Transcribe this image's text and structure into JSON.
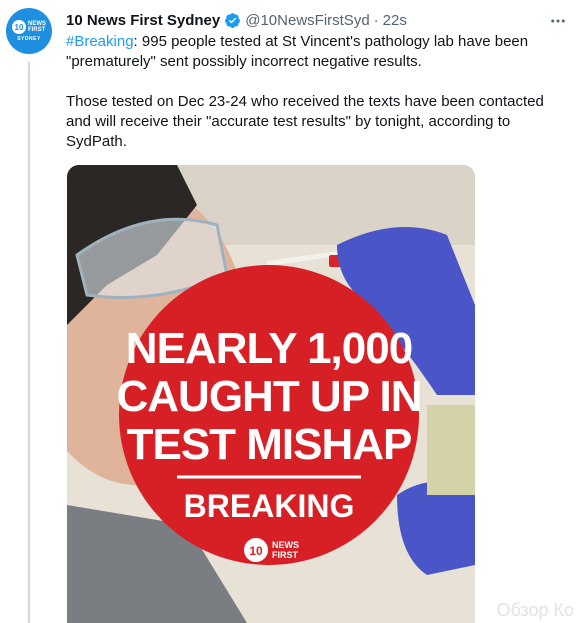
{
  "tweet": {
    "author_name": "10 News First Sydney",
    "handle": "@10NewsFirstSyd",
    "separator": "·",
    "timestamp": "22s",
    "more_icon": "more-horizontal-icon",
    "verified_icon": "verified-badge-icon",
    "hashtag": "#Breaking",
    "text_after_hashtag": ": 995 people tested at St Vincent's pathology lab have been \"prematurely\" sent possibly incorrect negative results.\n\nThose tested on Dec 23-24 who received the texts have been contacted and will receive their \"accurate test results\" by tonight, according to SydPath."
  },
  "avatar": {
    "logo_number": "10",
    "logo_line1": "NEWS",
    "logo_line2": "FIRST",
    "city": "SYDNEY"
  },
  "media": {
    "headline_line1": "NEARLY 1,000",
    "headline_line2": "CAUGHT UP IN",
    "headline_line3": "TEST MISHAP",
    "label": "BREAKING",
    "logo_number": "10",
    "logo_line1": "NEWS",
    "logo_line2": "FIRST",
    "circle_color": "#d71f26",
    "glove_color": "#4a56c8"
  },
  "watermark": "Обзор Ко"
}
